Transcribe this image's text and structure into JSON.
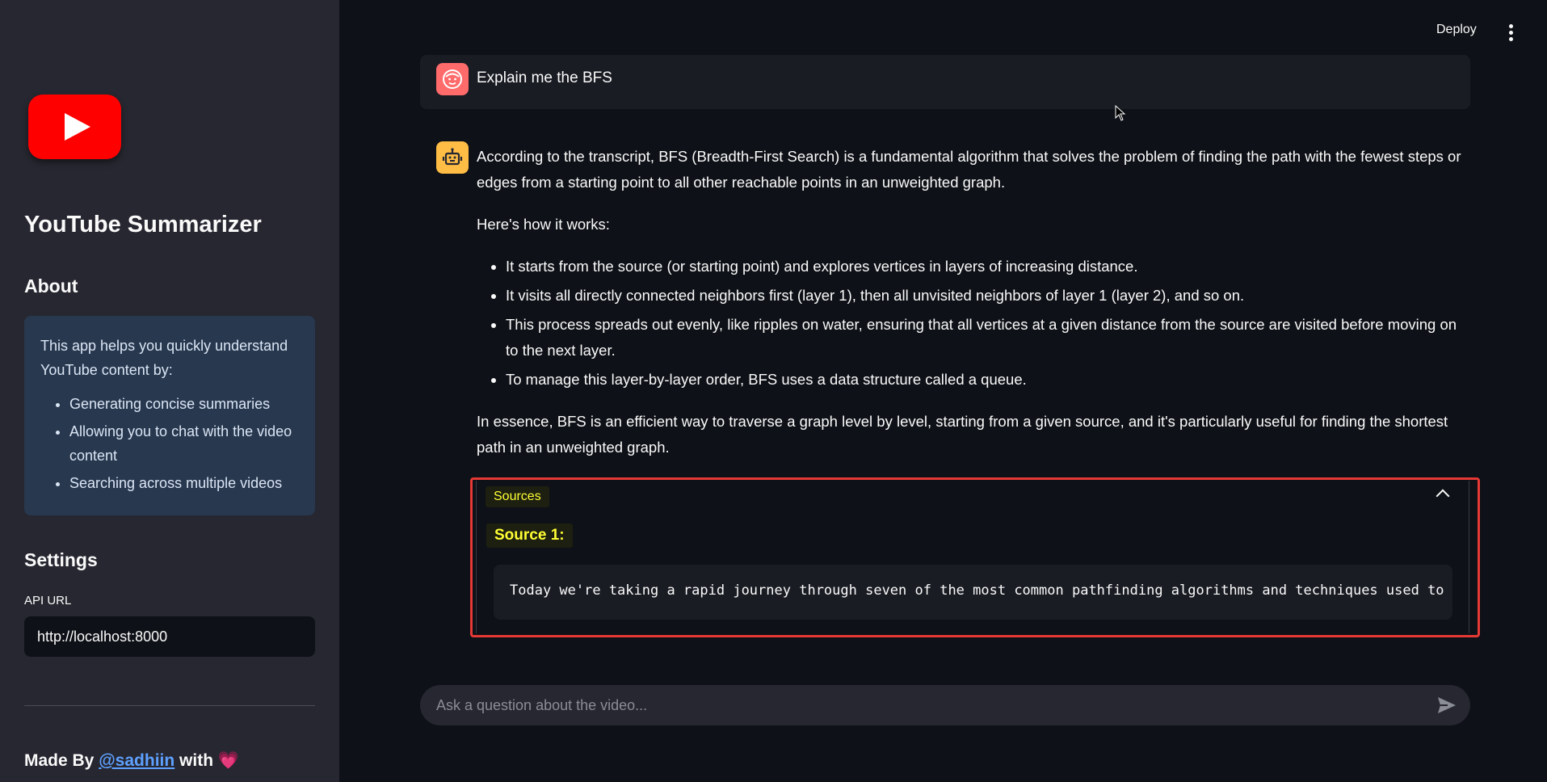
{
  "topbar": {
    "deploy_label": "Deploy",
    "menu_icon": "kebab-menu-icon"
  },
  "sidebar": {
    "logo_icon": "youtube-logo-icon",
    "app_title": "YouTube Summarizer",
    "about_heading": "About",
    "about_intro": "This app helps you quickly understand YouTube content by:",
    "about_items": [
      "Generating concise summaries",
      "Allowing you to chat with the video content",
      "Searching across multiple videos"
    ],
    "settings_heading": "Settings",
    "api_label": "API URL",
    "api_value": "http://localhost:8000",
    "made_by_prefix": "Made By",
    "made_by_link": "@sadhiin",
    "made_by_suffix": "with",
    "heart_icon": "heart-icon",
    "heart_glyph": "💗"
  },
  "chat": {
    "user_message": "Explain me the BFS",
    "assistant": {
      "intro": "According to the transcript, BFS (Breadth-First Search) is a fundamental algorithm that solves the problem of finding the path with the fewest steps or edges from a starting point to all other reachable points in an unweighted graph.",
      "how_label": "Here's how it works:",
      "bullets": [
        "It starts from the source (or starting point) and explores vertices in layers of increasing distance.",
        "It visits all directly connected neighbors first (layer 1), then all unvisited neighbors of layer 1 (layer 2), and so on.",
        "This process spreads out evenly, like ripples on water, ensuring that all vertices at a given distance from the source are visited before moving on to the next layer.",
        "To manage this layer-by-layer order, BFS uses a data structure called a queue."
      ],
      "conclusion": "In essence, BFS is an efficient way to traverse a graph level by level, starting from a given source, and it's particularly useful for finding the shortest path in an unweighted graph."
    },
    "sources": {
      "label": "Sources",
      "source_title": "Source 1:",
      "source_text": "Today we're taking a rapid journey through seven of the most common pathfinding algorithms and techniques used to"
    },
    "input_placeholder": "Ask a question about the video...",
    "send_icon": "send-icon"
  },
  "colors": {
    "sidebar_bg": "#262730",
    "main_bg": "#0e1117",
    "about_box_bg": "#28384f",
    "highlight_text": "#ffff33",
    "outline_red": "#e53935",
    "link_blue": "#5ea0ff"
  }
}
